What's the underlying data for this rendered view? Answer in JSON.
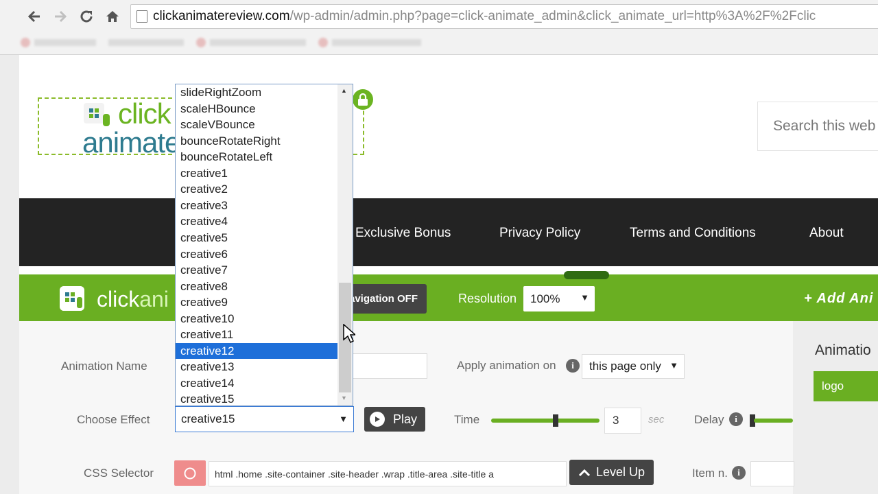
{
  "browser": {
    "url_domain": "clickanimatereview.com",
    "url_rest": "/wp-admin/admin.php?page=click-animate_admin&click_animate_url=http%3A%2F%2Fclic",
    "bookmarks": [
      "",
      "",
      "",
      "",
      ""
    ]
  },
  "site": {
    "logo_line1": "click",
    "logo_line2": "animate",
    "search_placeholder": "Search this web",
    "nav": [
      "Exclusive Bonus",
      "Privacy Policy",
      "Terms and Conditions",
      "About"
    ]
  },
  "toolbar": {
    "logo_text_a": "click",
    "logo_text_b": "ani",
    "navigation_toggle": "avigation OFF",
    "resolution_label": "Resolution",
    "resolution_value": "100%",
    "add_animation": "+ Add Ani"
  },
  "form": {
    "animation_name_label": "Animation Name",
    "apply_on_label": "Apply animation on",
    "apply_on_value": "this page only",
    "choose_effect_label": "Choose Effect",
    "effect_value": "creative15",
    "play_label": "Play",
    "time_label": "Time",
    "time_value": "3",
    "time_unit": "sec",
    "delay_label": "Delay",
    "css_selector_label": "CSS Selector",
    "css_selector_value": "html .home .site-container .site-header .wrap .title-area .site-title a",
    "level_up_label": "Level Up",
    "item_n_label": "Item n."
  },
  "sidebar": {
    "title": "Animatio",
    "items": [
      "logo"
    ]
  },
  "dropdown": {
    "options": [
      "slideRightZoom",
      "scaleHBounce",
      "scaleVBounce",
      "bounceRotateRight",
      "bounceRotateLeft",
      "creative1",
      "creative2",
      "creative3",
      "creative4",
      "creative5",
      "creative6",
      "creative7",
      "creative8",
      "creative9",
      "creative10",
      "creative11",
      "creative12",
      "creative13",
      "creative14",
      "creative15"
    ],
    "highlighted": "creative12"
  },
  "colors": {
    "brand_green": "#6aaf22",
    "nav_dark": "#232323",
    "highlight_blue": "#1e6fd9"
  },
  "icons": [
    "back-arrow-icon",
    "forward-arrow-icon",
    "reload-icon",
    "home-icon",
    "page-icon",
    "lock-icon",
    "info-icon",
    "play-icon",
    "target-icon",
    "chevron-up-icon",
    "mouse-cursor-icon"
  ]
}
